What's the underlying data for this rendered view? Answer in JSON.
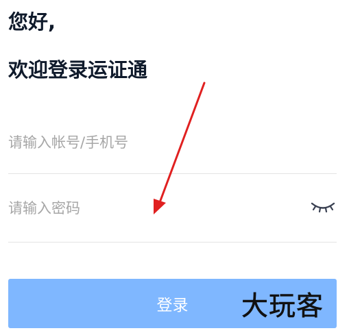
{
  "greeting": {
    "line1": "您好,",
    "line2": "欢迎登录运证通"
  },
  "form": {
    "account_placeholder": "请输入帐号/手机号",
    "password_placeholder": "请输入密码",
    "password_toggle_icon": "eye-closed-icon",
    "submit_label": "登录"
  },
  "watermark": {
    "text": "大玩客"
  },
  "colors": {
    "accent": "#7fb7ff",
    "heading": "#0f1a2b",
    "placeholder": "#a6a6a6",
    "divider": "#e3e3e3",
    "annotation_arrow": "#e02020"
  }
}
